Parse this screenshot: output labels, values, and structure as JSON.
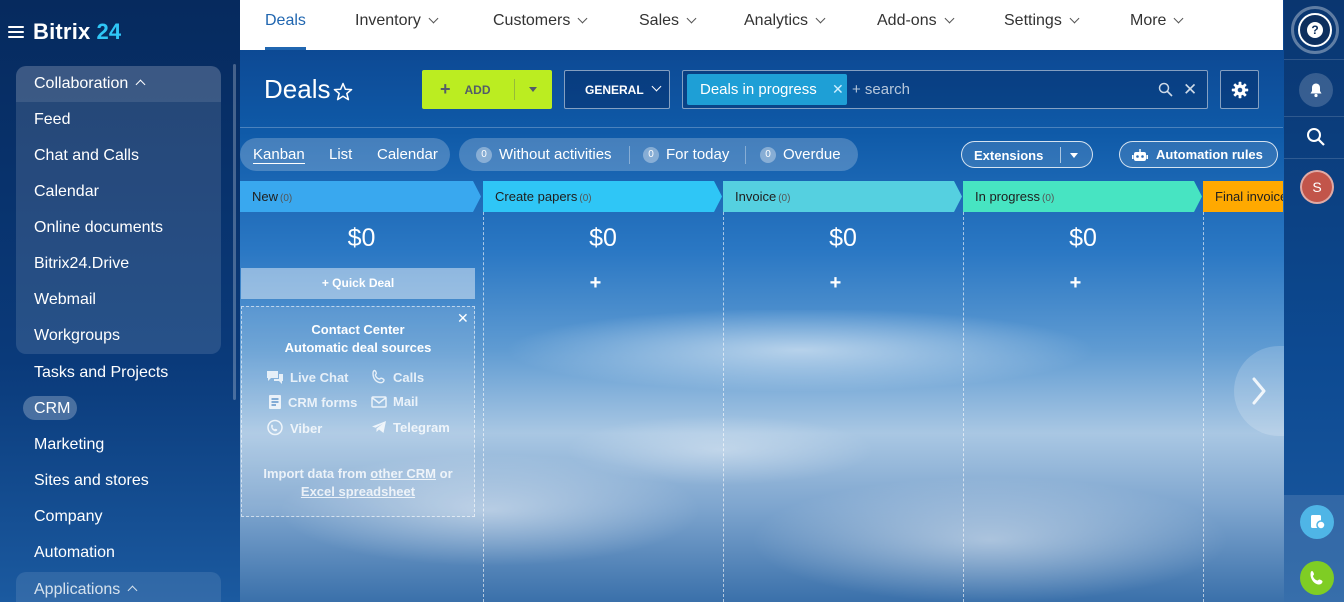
{
  "logo": {
    "brand": "Bitrix",
    "num": "24"
  },
  "sidebar": {
    "group_label": "Collaboration",
    "items": [
      "Feed",
      "Chat and Calls",
      "Calendar",
      "Online documents",
      "Bitrix24.Drive",
      "Webmail",
      "Workgroups"
    ],
    "main": [
      "Tasks and Projects",
      "CRM",
      "Marketing",
      "Sites and stores",
      "Company",
      "Automation"
    ],
    "apps_label": "Applications"
  },
  "topnav": {
    "tabs": [
      "Deals",
      "Inventory",
      "Customers",
      "Sales",
      "Analytics",
      "Add-ons",
      "Settings",
      "More"
    ]
  },
  "toolbar": {
    "title": "Deals",
    "add_label": "ADD",
    "general_label": "GENERAL",
    "filter_chip": "Deals in progress",
    "search_placeholder": "+ search"
  },
  "views": [
    "Kanban",
    "List",
    "Calendar"
  ],
  "counters": [
    {
      "count": "0",
      "label": "Without activities"
    },
    {
      "count": "0",
      "label": "For today"
    },
    {
      "count": "0",
      "label": "Overdue"
    }
  ],
  "extensions_label": "Extensions",
  "automation_label": "Automation rules",
  "columns": [
    {
      "name": "New",
      "count": "(0)",
      "sum": "$0",
      "color": "#39a8ef"
    },
    {
      "name": "Create papers",
      "count": "(0)",
      "sum": "$0",
      "color": "#2fc6f6"
    },
    {
      "name": "Invoice",
      "count": "(0)",
      "sum": "$0",
      "color": "#55d0e0"
    },
    {
      "name": "In progress",
      "count": "(0)",
      "sum": "$0",
      "color": "#47e4c2"
    },
    {
      "name": "Final invoice",
      "count": "",
      "sum": "",
      "color": "#ffa900"
    }
  ],
  "quick_deal": "+ Quick Deal",
  "contact_center": {
    "title1": "Contact Center",
    "title2": "Automatic deal sources",
    "sources": [
      "Live Chat",
      "Calls",
      "CRM forms",
      "Mail",
      "Viber",
      "Telegram"
    ],
    "import_prefix": "Import data from",
    "import_link1": "other CRM",
    "import_or": "or",
    "import_link2": "Excel spreadsheet"
  },
  "avatar_initial": "S"
}
